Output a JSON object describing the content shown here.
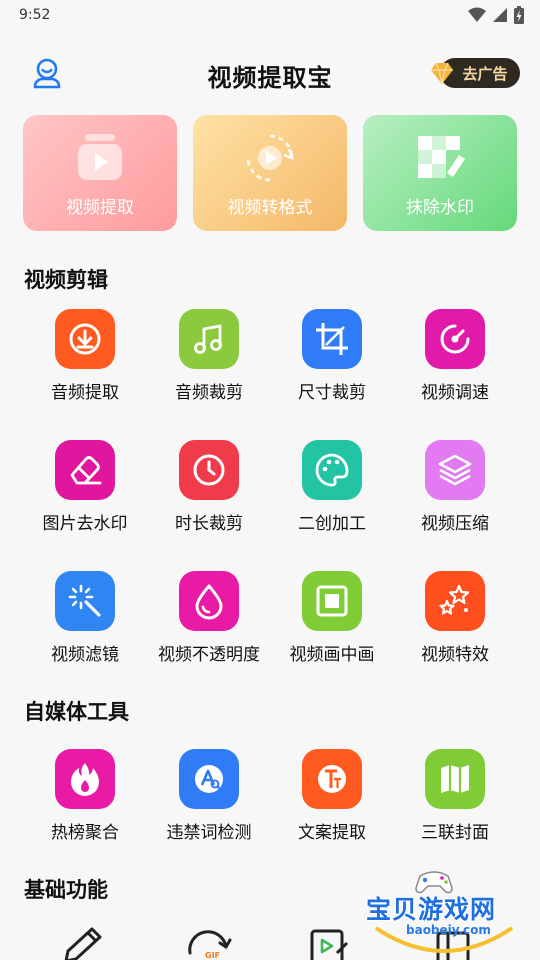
{
  "status_bar": {
    "time": "9:52",
    "icons": [
      "wifi-icon",
      "signal-icon",
      "battery-charging-icon"
    ]
  },
  "header": {
    "title": "视频提取宝",
    "remove_ads_label": "去广告"
  },
  "top_cards": [
    {
      "label": "视频提取",
      "icon": "video-play-icon"
    },
    {
      "label": "视频转格式",
      "icon": "video-convert-icon"
    },
    {
      "label": "抹除水印",
      "icon": "erase-watermark-icon"
    }
  ],
  "sections": {
    "video_edit": "视频剪辑",
    "self_media": "自媒体工具",
    "basic": "基础功能"
  },
  "video_edit_tools": [
    {
      "label": "音频提取",
      "icon": "audio-download-icon",
      "color": "#ff5a1f"
    },
    {
      "label": "音频裁剪",
      "icon": "music-note-icon",
      "color": "#8bc93f"
    },
    {
      "label": "尺寸裁剪",
      "icon": "crop-icon",
      "color": "#2f7cf6"
    },
    {
      "label": "视频调速",
      "icon": "speed-icon",
      "color": "#e21aa9"
    },
    {
      "label": "图片去水印",
      "icon": "eraser-icon",
      "color": "#e0179e"
    },
    {
      "label": "时长裁剪",
      "icon": "clock-icon",
      "color": "#f03c4a"
    },
    {
      "label": "二创加工",
      "icon": "palette-icon",
      "color": "#22c4a3"
    },
    {
      "label": "视频压缩",
      "icon": "layers-icon",
      "color": "#e27bf2"
    },
    {
      "label": "视频滤镜",
      "icon": "magic-wand-icon",
      "color": "#2f86f2"
    },
    {
      "label": "视频不透明度",
      "icon": "droplet-icon",
      "color": "#e81aa6"
    },
    {
      "label": "视频画中画",
      "icon": "pip-icon",
      "color": "#80cc37"
    },
    {
      "label": "视频特效",
      "icon": "stars-icon",
      "color": "#ff4f1f"
    }
  ],
  "self_media_tools": [
    {
      "label": "热榜聚合",
      "icon": "flame-icon",
      "color": "#e81aa6"
    },
    {
      "label": "违禁词检测",
      "icon": "text-search-icon",
      "color": "#2f7cf6"
    },
    {
      "label": "文案提取",
      "icon": "text-extract-icon",
      "color": "#ff5a1f"
    },
    {
      "label": "三联封面",
      "icon": "map-icon",
      "color": "#80cc37"
    }
  ],
  "basic_tools": [
    {
      "icon": "pencil-icon"
    },
    {
      "icon": "refresh-gif-icon"
    },
    {
      "icon": "video-edit-icon"
    },
    {
      "icon": "doc-icon"
    }
  ],
  "watermark": {
    "text": "宝贝游戏网",
    "url": "baobeiy.com"
  }
}
